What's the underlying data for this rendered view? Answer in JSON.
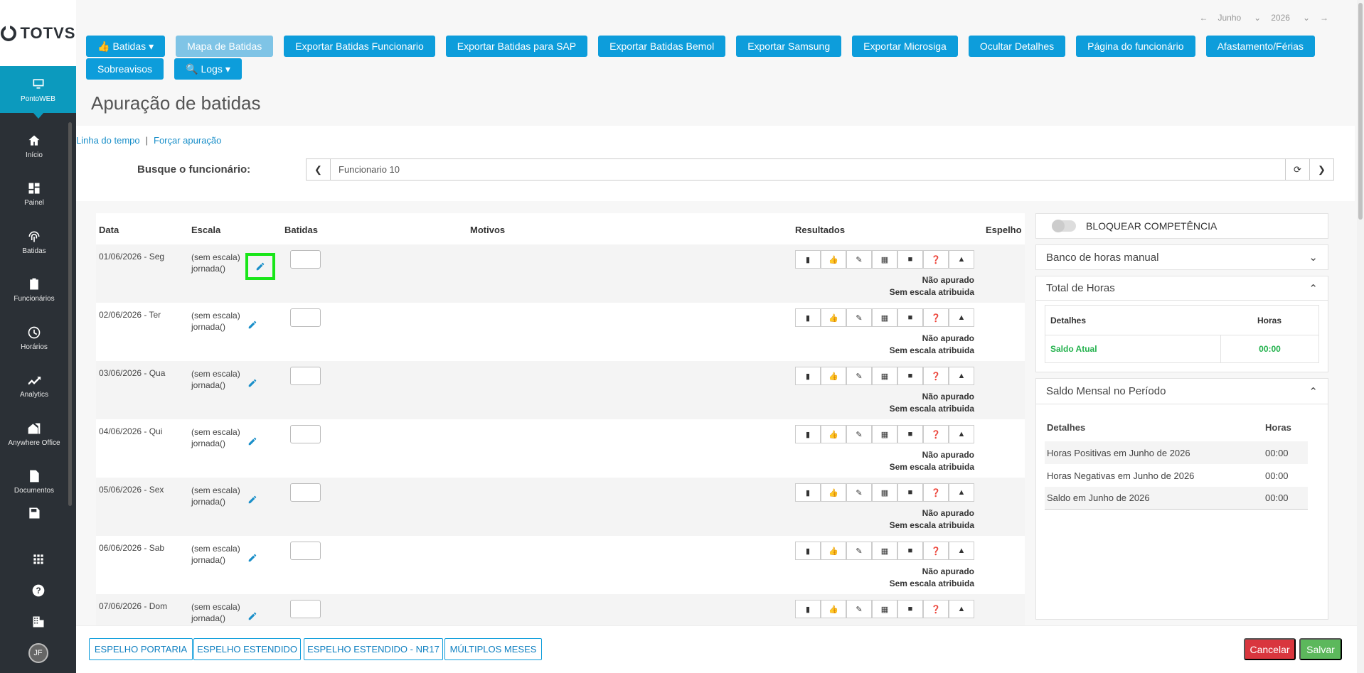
{
  "app": {
    "logo": "TOTVS",
    "module": "PontoWEB"
  },
  "sidebar": {
    "items": [
      {
        "label": "Início",
        "icon": "home-icon"
      },
      {
        "label": "Painel",
        "icon": "dashboard-icon"
      },
      {
        "label": "Batidas",
        "icon": "fingerprint-icon"
      },
      {
        "label": "Funcionários",
        "icon": "badge-icon"
      },
      {
        "label": "Horários",
        "icon": "clock-icon"
      },
      {
        "label": "Analytics",
        "icon": "trending-icon"
      },
      {
        "label": "Anywhere Office",
        "icon": "house-office-icon"
      },
      {
        "label": "Documentos",
        "icon": "document-icon"
      }
    ],
    "avatar": "JF"
  },
  "period": {
    "month": "Junho",
    "year": "2026"
  },
  "toolbar": {
    "batidas": "Batidas",
    "mapa": "Mapa de Batidas",
    "exp_func": "Exportar Batidas Funcionario",
    "exp_sap": "Exportar Batidas para SAP",
    "exp_bemol": "Exportar Batidas Bemol",
    "exp_samsung": "Exportar Samsung",
    "exp_microsiga": "Exportar Microsiga",
    "ocultar": "Ocultar Detalhes",
    "pagina": "Página do funcionário",
    "afast": "Afastamento/Férias",
    "sobreavisos": "Sobreavisos",
    "logs": "Logs"
  },
  "page": {
    "title": "Apuração de batidas"
  },
  "links": {
    "timeline": "Linha do tempo",
    "sep": "|",
    "force": "Forçar apuração"
  },
  "search": {
    "label": "Busque o funcionário:",
    "value": "Funcionario 10"
  },
  "table": {
    "headers": {
      "data": "Data",
      "escala": "Escala",
      "batidas": "Batidas",
      "motivos": "Motivos",
      "resultados": "Resultados",
      "espelho": "Espelho"
    },
    "rows": [
      {
        "date": "01/06/2026 - Seg",
        "escala": "(sem escala)",
        "jornada": "jornada()",
        "status": "Não apurado",
        "status2": "Sem escala atribuida"
      },
      {
        "date": "02/06/2026 - Ter",
        "escala": "(sem escala)",
        "jornada": "jornada()",
        "status": "Não apurado",
        "status2": "Sem escala atribuida"
      },
      {
        "date": "03/06/2026 - Qua",
        "escala": "(sem escala)",
        "jornada": "jornada()",
        "status": "Não apurado",
        "status2": "Sem escala atribuida"
      },
      {
        "date": "04/06/2026 - Qui",
        "escala": "(sem escala)",
        "jornada": "jornada()",
        "status": "Não apurado",
        "status2": "Sem escala atribuida"
      },
      {
        "date": "05/06/2026 - Sex",
        "escala": "(sem escala)",
        "jornada": "jornada()",
        "status": "Não apurado",
        "status2": "Sem escala atribuida"
      },
      {
        "date": "06/06/2026 - Sab",
        "escala": "(sem escala)",
        "jornada": "jornada()",
        "status": "Não apurado",
        "status2": "Sem escala atribuida"
      },
      {
        "date": "07/06/2026 - Dom",
        "escala": "(sem escala)",
        "jornada": "jornada()",
        "status": "",
        "status2": ""
      }
    ]
  },
  "right": {
    "bloquear": "BLOQUEAR COMPETÊNCIA",
    "banco": "Banco de horas manual",
    "total": {
      "title": "Total de Horas",
      "col1": "Detalhes",
      "col2": "Horas",
      "row_label": "Saldo Atual",
      "row_value": "00:00"
    },
    "saldo": {
      "title": "Saldo Mensal no Período",
      "col1": "Detalhes",
      "col2": "Horas",
      "rows": [
        {
          "label": "Horas Positivas em Junho de 2026",
          "value": "00:00"
        },
        {
          "label": "Horas Negativas em Junho de 2026",
          "value": "00:00"
        },
        {
          "label": "Saldo em Junho de 2026",
          "value": "00:00"
        }
      ]
    }
  },
  "footer": {
    "portaria": "ESPELHO PORTARIA",
    "estendido": "ESPELHO ESTENDIDO",
    "nr17": "ESPELHO ESTENDIDO - NR17",
    "multiplos": "MÚLTIPLOS MESES",
    "cancelar": "Cancelar",
    "salvar": "Salvar"
  },
  "colors": {
    "primary": "#0d9ddb",
    "sidebar": "#2b3036",
    "active": "#0c9abe",
    "cancel": "#d9363e",
    "save": "#5cb85c",
    "highlight": "#19e619"
  }
}
